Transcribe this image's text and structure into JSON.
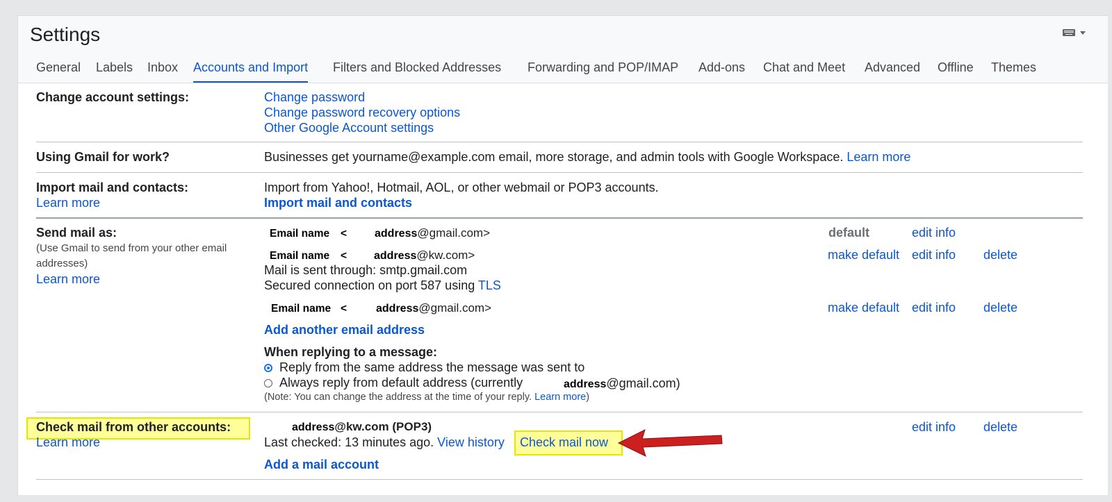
{
  "header": {
    "title": "Settings",
    "input_tools_icon": "keyboard-icon"
  },
  "tabs": [
    {
      "label": "General"
    },
    {
      "label": "Labels"
    },
    {
      "label": "Inbox"
    },
    {
      "label": "Accounts and Import",
      "active": true
    },
    {
      "label": "Filters and Blocked Addresses"
    },
    {
      "label": "Forwarding and POP/IMAP"
    },
    {
      "label": "Add-ons"
    },
    {
      "label": "Chat and Meet"
    },
    {
      "label": "Advanced"
    },
    {
      "label": "Offline"
    },
    {
      "label": "Themes"
    }
  ],
  "change_account": {
    "label": "Change account settings:",
    "links": [
      "Change password",
      "Change password recovery options",
      "Other Google Account settings"
    ]
  },
  "work": {
    "label": "Using Gmail for work?",
    "text": "Businesses get yourname@example.com email, more storage, and admin tools with Google Workspace.",
    "link": "Learn more"
  },
  "import": {
    "label": "Import mail and contacts:",
    "learn_more": "Learn more",
    "text": "Import from Yahoo!, Hotmail, AOL, or other webmail or POP3 accounts.",
    "action": "Import mail and contacts"
  },
  "send_as": {
    "label": "Send mail as:",
    "sub1": "(Use Gmail to send from your other email",
    "sub2": "addresses)",
    "learn_more": "Learn more",
    "addresses": [
      {
        "name": "Email name",
        "lt": "<",
        "addr_bold": "address",
        "addr_rest": "@gmail.com>",
        "status": "default",
        "edit": "edit info"
      },
      {
        "name": "Email name",
        "lt": "<",
        "addr_bold": "address",
        "addr_rest": "@kw.com>",
        "make_default": "make default",
        "edit": "edit info",
        "delete": "delete",
        "smtp": "Mail is sent through: smtp.gmail.com",
        "secured": "Secured connection on port 587 using",
        "tls": "TLS"
      },
      {
        "name": "Email name",
        "lt": "<",
        "addr_bold": "address",
        "addr_rest": "@gmail.com>",
        "make_default": "make default",
        "edit": "edit info",
        "delete": "delete"
      }
    ],
    "add_another": "Add another email address",
    "reply_heading": "When replying to a message:",
    "reply_opt1": "Reply from the same address the message was sent to",
    "reply_opt2_a": "Always reply from default address (currently",
    "reply_opt2_bold": "address",
    "reply_opt2_b": "@gmail.com)",
    "note_a": "(Note: You can change the address at the time of your reply.",
    "note_link": "Learn more",
    "note_b": ")"
  },
  "check_mail": {
    "label": "Check mail from other accounts:",
    "learn_more": "Learn more",
    "account_bold": "address",
    "account_rest": "@kw.com (POP3)",
    "last_checked": "Last checked: 13 minutes ago.",
    "view_history": "View history",
    "check_now": "Check mail now",
    "add_account": "Add a mail account",
    "edit": "edit info",
    "delete": "delete"
  },
  "colors": {
    "accent": "#0b57d0",
    "highlight": "#ffff99",
    "arrow": "#cc1f1f"
  }
}
